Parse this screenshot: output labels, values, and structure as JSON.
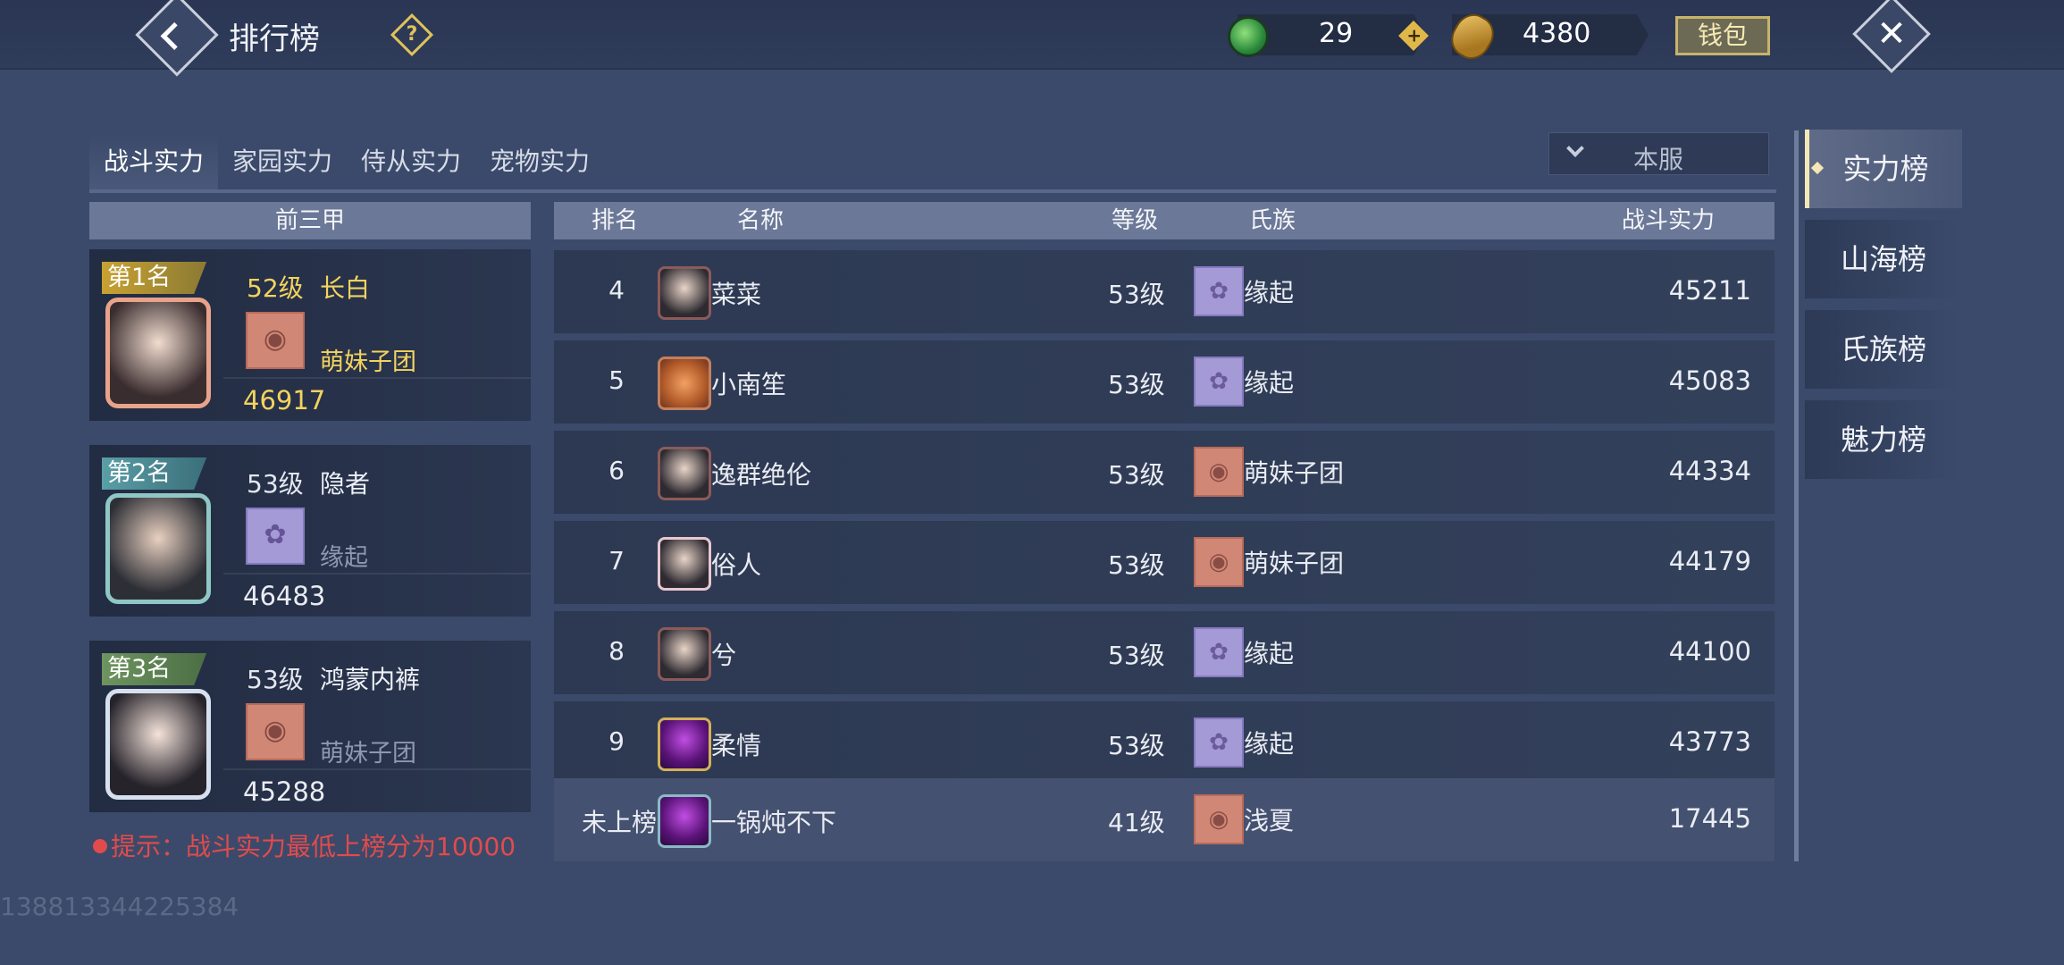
{
  "header": {
    "title": "排行榜",
    "help_icon": "question-diamond-icon",
    "jade_count": "29",
    "coin_count": "4380",
    "wallet_label": "钱包"
  },
  "tabs": [
    {
      "label": "战斗实力",
      "active": true
    },
    {
      "label": "家园实力",
      "active": false
    },
    {
      "label": "侍从实力",
      "active": false
    },
    {
      "label": "宠物实力",
      "active": false
    }
  ],
  "server_filter": {
    "selected": "本服"
  },
  "top3": {
    "header": "前三甲",
    "entries": [
      {
        "rank_label": "第1名",
        "level": "52级",
        "name": "长白",
        "clan": "萌妹子团",
        "clan_emblem": "red",
        "power": "46917"
      },
      {
        "rank_label": "第2名",
        "level": "53级",
        "name": "隐者",
        "clan": "缘起",
        "clan_emblem": "purple",
        "power": "46483"
      },
      {
        "rank_label": "第3名",
        "level": "53级",
        "name": "鸿蒙内裤",
        "clan": "萌妹子团",
        "clan_emblem": "red",
        "power": "45288"
      }
    ]
  },
  "table": {
    "headers": {
      "rank": "排名",
      "name": "名称",
      "level": "等级",
      "clan": "氏族",
      "power": "战斗实力"
    },
    "rows": [
      {
        "rank": "4",
        "name": "菜菜",
        "level": "53级",
        "clan": "缘起",
        "clan_emblem": "purple",
        "power": "45211"
      },
      {
        "rank": "5",
        "name": "小南笙",
        "level": "53级",
        "clan": "缘起",
        "clan_emblem": "purple",
        "power": "45083"
      },
      {
        "rank": "6",
        "name": "逸群绝伦",
        "level": "53级",
        "clan": "萌妹子团",
        "clan_emblem": "red",
        "power": "44334"
      },
      {
        "rank": "7",
        "name": "俗人",
        "level": "53级",
        "clan": "萌妹子团",
        "clan_emblem": "red",
        "power": "44179"
      },
      {
        "rank": "8",
        "name": "兮",
        "level": "53级",
        "clan": "缘起",
        "clan_emblem": "purple",
        "power": "44100"
      },
      {
        "rank": "9",
        "name": "柔情",
        "level": "53级",
        "clan": "缘起",
        "clan_emblem": "purple",
        "power": "43773"
      }
    ],
    "self_row": {
      "rank": "未上榜",
      "name": "一锅炖不下",
      "level": "41级",
      "clan": "浅夏",
      "clan_emblem": "red",
      "power": "17445"
    }
  },
  "hint": "提示：战斗实力最低上榜分为10000",
  "footer_id": "138813344225384",
  "side_menu": [
    {
      "label": "实力榜",
      "active": true
    },
    {
      "label": "山海榜",
      "active": false
    },
    {
      "label": "氏族榜",
      "active": false
    },
    {
      "label": "魅力榜",
      "active": false
    }
  ],
  "colors": {
    "background": "#3b4a6b",
    "gold_text": "#f3d35e",
    "hint_red": "#e14b4b",
    "emblem_red": "#d08775",
    "emblem_purple": "#a49ad6"
  }
}
